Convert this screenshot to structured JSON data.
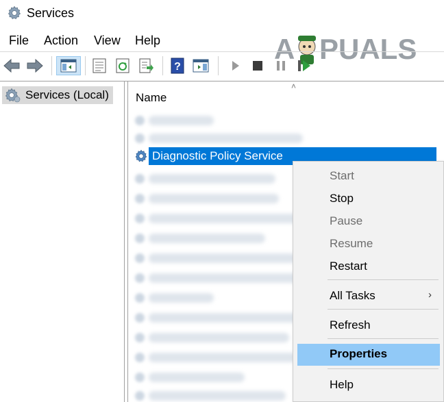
{
  "window": {
    "title": "Services"
  },
  "menu": [
    "File",
    "Action",
    "View",
    "Help"
  ],
  "watermark": {
    "text_left": "A",
    "text_right": "PUALS"
  },
  "tree": {
    "root_label": "Services (Local)"
  },
  "list": {
    "column_name": "Name",
    "selected_service": "Diagnostic Policy Service"
  },
  "context_menu": {
    "items": [
      {
        "label": "Start",
        "enabled": false
      },
      {
        "label": "Stop",
        "enabled": true
      },
      {
        "label": "Pause",
        "enabled": false
      },
      {
        "label": "Resume",
        "enabled": false
      },
      {
        "label": "Restart",
        "enabled": true
      },
      {
        "label": "All Tasks",
        "enabled": true,
        "submenu": true
      },
      {
        "label": "Refresh",
        "enabled": true
      },
      {
        "label": "Properties",
        "enabled": true,
        "highlighted": true
      },
      {
        "label": "Help",
        "enabled": true
      }
    ]
  },
  "colors": {
    "selection": "#0078d7",
    "menu_highlight": "#91c9f7",
    "toolbar_active": "#cce4f7"
  },
  "icons": [
    "gear-icon",
    "back-arrow-icon",
    "forward-arrow-icon",
    "console-tree-icon",
    "properties-icon",
    "refresh-icon",
    "export-list-icon",
    "help-icon",
    "show-pane-icon",
    "play-icon",
    "stop-icon",
    "pause-icon",
    "resume-icon"
  ]
}
